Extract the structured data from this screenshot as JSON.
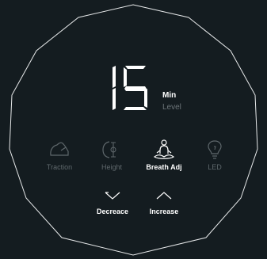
{
  "display": {
    "value": "15",
    "unit": "Min",
    "subtitle": "Level"
  },
  "functions": [
    {
      "label": "Traction",
      "icon": "foot-traction-icon",
      "active": false
    },
    {
      "label": "Height",
      "icon": "height-adjust-icon",
      "active": false
    },
    {
      "label": "Breath Adj",
      "icon": "meditation-icon",
      "active": true
    },
    {
      "label": "LED",
      "icon": "bulb-icon",
      "active": false
    }
  ],
  "adjust": {
    "decrease_label": "Decreace",
    "increase_label": "Increase"
  },
  "colors": {
    "background": "#141c20",
    "outline": "#e6e8e9",
    "active": "#ffffff",
    "inactive": "#5f686c"
  }
}
